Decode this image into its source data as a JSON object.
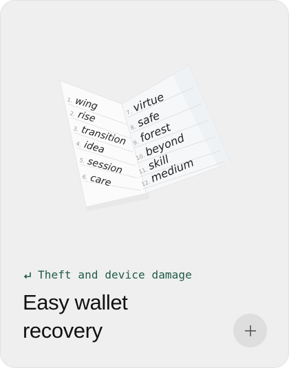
{
  "card": {
    "tag_label": "Theft and device damage",
    "title_line1": "Easy wallet",
    "title_line2": "recovery",
    "expand_icon": "plus-icon",
    "tag_icon": "return-arrow-icon"
  },
  "recovery_sheet": {
    "left_page": [
      {
        "num": "1.",
        "word": "wing"
      },
      {
        "num": "2.",
        "word": "rise"
      },
      {
        "num": "3.",
        "word": "transition"
      },
      {
        "num": "4.",
        "word": "idea"
      },
      {
        "num": "5.",
        "word": "session"
      },
      {
        "num": "6.",
        "word": "care"
      }
    ],
    "right_page": [
      {
        "num": "7.",
        "word": "virtue"
      },
      {
        "num": "8.",
        "word": "safe"
      },
      {
        "num": "9.",
        "word": "forest"
      },
      {
        "num": "10.",
        "word": "beyond"
      },
      {
        "num": "11.",
        "word": "skill"
      },
      {
        "num": "12.",
        "word": "medium"
      }
    ]
  },
  "colors": {
    "card_bg": "#efefef",
    "tag_text": "#1f5a47",
    "title_text": "#111111",
    "button_bg": "#dedede"
  }
}
